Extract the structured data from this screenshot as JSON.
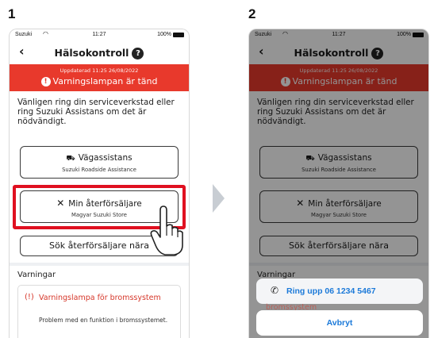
{
  "steps": {
    "first": "1",
    "second": "2"
  },
  "status_bar": {
    "carrier": "Suzuki",
    "time": "11:27",
    "battery": "100%"
  },
  "header": {
    "title": "Hälsokontroll",
    "help_glyph": "?",
    "back_glyph": "‹"
  },
  "banner": {
    "updated": "Uppdaterad 11:25 26/08/2022",
    "warning": "Varningslampan är tänd",
    "color": "#e8392c"
  },
  "intro_text": "Vänligen ring din serviceverkstad eller ring Suzuki Assistans om det är nödvändigt.",
  "buttons": {
    "roadside": {
      "title": "Vägassistans",
      "subtitle": "Suzuki Roadside Assistance",
      "icon": "tow-truck-icon"
    },
    "dealer": {
      "title": "Min återförsäljare",
      "subtitle": "Magyar Suzuki Store",
      "icon": "tools-icon"
    },
    "find_dealer": {
      "title": "Sök återförsäljare nära"
    }
  },
  "warnings": {
    "section_label": "Varningar",
    "item": {
      "title": "Varningslampa för bromssystem",
      "description": "Problem med en funktion i bromssystemet.",
      "icon": "brake-warning-icon"
    }
  },
  "action_sheet": {
    "call_label": "Ring upp 06 1234 5467",
    "cancel_label": "Avbryt",
    "peek_text": "bromssystem",
    "accent": "#1c7ad9"
  },
  "highlight_color": "#e01020"
}
